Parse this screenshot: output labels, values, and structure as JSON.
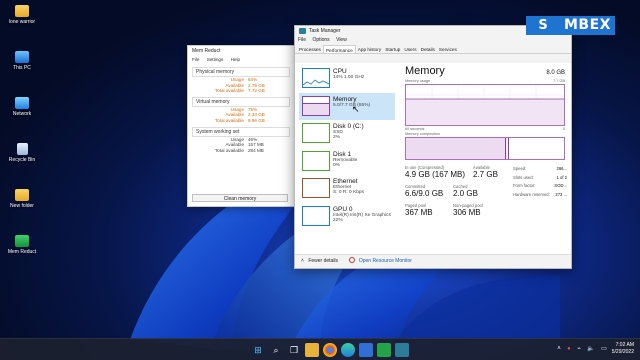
{
  "desktop": {
    "icons": [
      {
        "label": "lone warrior",
        "icon": "folder-icon"
      },
      {
        "label": "This PC",
        "icon": "computer-icon"
      },
      {
        "label": "Network",
        "icon": "network-icon"
      },
      {
        "label": "Recycle Bin",
        "icon": "recycle-bin-icon"
      },
      {
        "label": "New folder",
        "icon": "folder-icon"
      },
      {
        "label": "Mem Reduct",
        "icon": "mem-reduct-icon"
      }
    ]
  },
  "mem_reduct": {
    "title": "Mem Reduct",
    "menu": [
      "File",
      "Settings",
      "Help"
    ],
    "physical": {
      "label": "Physical memory",
      "rows": [
        {
          "key": "Usage",
          "value": "84%"
        },
        {
          "key": "Available",
          "value": "2.75 GB"
        },
        {
          "key": "Total available",
          "value": "7.72 GB"
        }
      ]
    },
    "virtual": {
      "label": "Virtual memory",
      "rows": [
        {
          "key": "Usage",
          "value": "75%"
        },
        {
          "key": "Available",
          "value": "2.34 GB"
        },
        {
          "key": "Total available",
          "value": "8.96 GB"
        }
      ]
    },
    "working": {
      "label": "System working set",
      "rows": [
        {
          "key": "Usage",
          "value": "46%"
        },
        {
          "key": "Available",
          "value": "157 MB"
        },
        {
          "key": "Total available",
          "value": "284 MB"
        }
      ]
    },
    "clear_button": "Clean memory",
    "accent": "#d76b10"
  },
  "task_manager": {
    "title": "Task Manager",
    "menu": [
      "File",
      "Options",
      "View"
    ],
    "tabs": [
      "Processes",
      "Performance",
      "App history",
      "Startup",
      "Users",
      "Details",
      "Services"
    ],
    "active_tab": "Performance",
    "sidebar": [
      {
        "name": "CPU",
        "sub": "14% 1.00 GHz",
        "color": "#1b7fc4"
      },
      {
        "name": "Memory",
        "sub": "5.0/7.7 GB (65%)",
        "color": "#8e3fa3"
      },
      {
        "name": "Disk 0 (C:)",
        "sub1": "SSD",
        "sub2": "2%",
        "color": "#4ea72e"
      },
      {
        "name": "Disk 1",
        "sub1": "Removable",
        "sub2": "0%",
        "color": "#4ea72e"
      },
      {
        "name": "Ethernet",
        "sub1": "Ethernet",
        "sub2": "S: 0 R: 0 Kbps",
        "color": "#a0522d"
      },
      {
        "name": "GPU 0",
        "sub1": "Intel(R) Iris(R) Xe Graphics",
        "sub2": "22%",
        "color": "#1b7fc4"
      }
    ],
    "detail": {
      "title": "Memory",
      "total": "8.0 GB",
      "usage_label": "Memory usage",
      "usage_max": "7.7 GB",
      "axis_left": "60 seconds",
      "axis_right": "0",
      "composition_label": "Memory composition",
      "usage_level": 0.65,
      "stats": {
        "in_use_label": "In use (Compressed)",
        "in_use": "4.9 GB (167 MB)",
        "available_label": "Available",
        "available": "2.7 GB",
        "committed_label": "Committed",
        "committed": "6.6/9.0 GB",
        "cached_label": "Cached",
        "cached": "2.0 GB",
        "paged_label": "Paged pool",
        "paged": "367 MB",
        "nonpaged_label": "Non-paged pool",
        "nonpaged": "306 MB"
      },
      "right_kv": [
        {
          "key": "Speed:",
          "value": "266..."
        },
        {
          "key": "Slots used:",
          "value": "1 of 2"
        },
        {
          "key": "Form factor:",
          "value": "SOD..."
        },
        {
          "key": "Hardware reserved:",
          "value": "273 ..."
        }
      ]
    },
    "footer": {
      "fewer": "Fewer details",
      "monitor": "Open Resource Monitor"
    },
    "graph_color": "#b06dbb"
  },
  "watermark": {
    "left": "S",
    "rest": "MBEX",
    "color": "#1f73d1"
  },
  "taskbar": {
    "time": "7:02 AM",
    "date": "5/29/2022"
  }
}
